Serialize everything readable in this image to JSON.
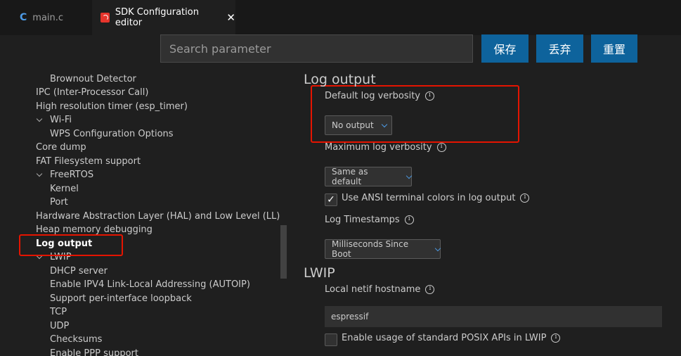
{
  "tabs": [
    {
      "icon": "c-file-icon",
      "glyph": "C",
      "label": "main.c"
    },
    {
      "icon": "espressif-logo-icon",
      "label": "SDK Configuration editor",
      "close_glyph": "✕"
    }
  ],
  "toolbar": {
    "search_placeholder": "Search parameter",
    "save_label": "保存",
    "discard_label": "丢弃",
    "reset_label": "重置",
    "button_color": "#0e639c"
  },
  "tree": {
    "items": [
      {
        "label": "Brownout Detector"
      },
      {
        "label": "IPC (Inter-Processor Call)"
      },
      {
        "label": "High resolution timer (esp_timer)"
      },
      {
        "label": "Wi-Fi",
        "expanded": true
      },
      {
        "label": "WPS Configuration Options"
      },
      {
        "label": "Core dump"
      },
      {
        "label": "FAT Filesystem support"
      },
      {
        "label": "FreeRTOS",
        "expanded": true
      },
      {
        "label": "Kernel"
      },
      {
        "label": "Port"
      },
      {
        "label": "Hardware Abstraction Layer (HAL) and Low Level (LL)"
      },
      {
        "label": "Heap memory debugging"
      },
      {
        "label": "Log output",
        "selected": true
      },
      {
        "label": "LWIP",
        "expanded": true
      },
      {
        "label": "DHCP server"
      },
      {
        "label": "Enable IPV4 Link-Local Addressing (AUTOIP)"
      },
      {
        "label": "Support per-interface loopback"
      },
      {
        "label": "TCP"
      },
      {
        "label": "UDP"
      },
      {
        "label": "Checksums"
      },
      {
        "label": "Enable PPP support"
      }
    ]
  },
  "log_output": {
    "title": "Log output",
    "default_verbosity_label": "Default log verbosity",
    "default_verbosity_value": "No output",
    "max_verbosity_label": "Maximum log verbosity",
    "max_verbosity_value": "Same as default",
    "ansi_colors_label": "Use ANSI terminal colors in log output",
    "ansi_colors_checked": true,
    "check_glyph": "✓",
    "timestamps_label": "Log Timestamps",
    "timestamps_value": "Milliseconds Since Boot"
  },
  "lwip": {
    "title": "LWIP",
    "hostname_label": "Local netif hostname",
    "hostname_value": "espressif",
    "posix_label": "Enable usage of standard POSIX APIs in LWIP",
    "posix_checked": false
  },
  "highlight_color": "#e51400"
}
